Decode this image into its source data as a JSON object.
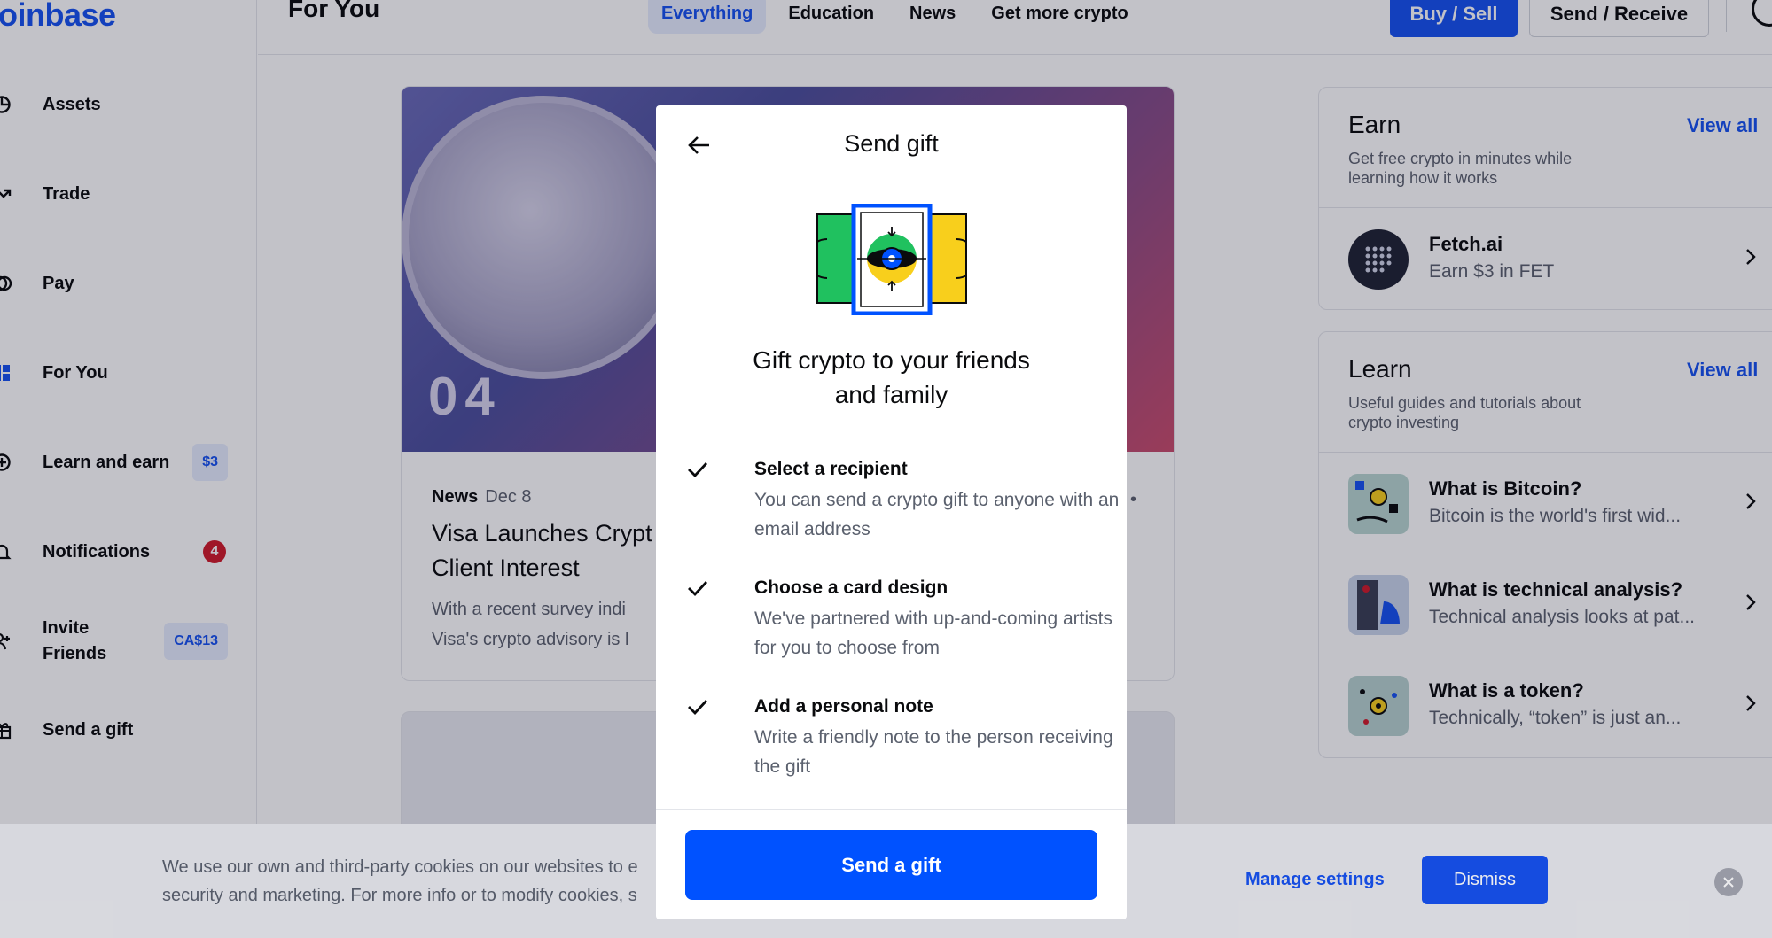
{
  "app": {
    "logo": "oinbase"
  },
  "sidebar": {
    "items": [
      {
        "label": "Assets",
        "icon": "pie-chart-icon"
      },
      {
        "label": "Trade",
        "icon": "trend-arrow-icon"
      },
      {
        "label": "Pay",
        "icon": "pay-icon"
      },
      {
        "label": "For You",
        "icon": "dashboard-icon"
      },
      {
        "label": "Learn and earn",
        "icon": "plus-circle-icon",
        "badge": "$3"
      },
      {
        "label": "Notifications",
        "icon": "bell-icon",
        "count": "4"
      },
      {
        "label": "Invite\nFriends",
        "icon": "add-user-icon",
        "badge": "CA$13"
      },
      {
        "label": "Send a gift",
        "icon": "gift-icon"
      }
    ]
  },
  "header": {
    "title": "For You",
    "tabs": [
      "Everything",
      "Education",
      "News",
      "Get more crypto"
    ],
    "active_tab": "Everything",
    "buy_sell": "Buy / Sell",
    "send_receive": "Send / Receive"
  },
  "feed": {
    "image_text": "04",
    "category": "News",
    "date": "Dec 8",
    "title": "Visa Launches Crypt\nClient Interest",
    "description": "With a recent survey indi\nVisa's crypto advisory is l",
    "dots": "•"
  },
  "earn": {
    "title": "Earn",
    "view_all": "View all",
    "subtitle": "Get free crypto in minutes while learning how it works",
    "items": [
      {
        "title": "Fetch.ai",
        "subtitle": "Earn $3 in FET",
        "thumb_color": "#1f2333"
      }
    ]
  },
  "learn": {
    "title": "Learn",
    "view_all": "View all",
    "subtitle": "Useful guides and tutorials about crypto investing",
    "items": [
      {
        "title": "What is Bitcoin?",
        "subtitle": "Bitcoin is the world's first wid...",
        "thumb_color": "#b9d6d0"
      },
      {
        "title": "What is technical analysis?",
        "subtitle": "Technical analysis looks at pat...",
        "thumb_color": "#c9d4ea"
      },
      {
        "title": "What is a token?",
        "subtitle": "Technically, “token” is just an...",
        "thumb_color": "#b7d2cf"
      }
    ]
  },
  "cookie_banner": {
    "text": "We use our own and third-party cookies on our websites to e\nsecurity and marketing. For more info or to modify cookies, s",
    "manage": "Manage settings",
    "dismiss": "Dismiss"
  },
  "modal": {
    "title": "Send gift",
    "heading": "Gift crypto to your friends\nand family",
    "steps": [
      {
        "title": "Select a recipient",
        "desc": "You can send a crypto gift to anyone with an email address"
      },
      {
        "title": "Choose a card design",
        "desc": "We've partnered with up-and-coming artists for you to choose from"
      },
      {
        "title": "Add a personal note",
        "desc": "Write a friendly note to the person receiving the gift"
      }
    ],
    "cta": "Send a gift"
  },
  "colors": {
    "brand": "#1652f0",
    "cta": "#0052ff",
    "badge_red": "#d01b2a",
    "gift_green": "#20c15f",
    "gift_yellow": "#f8cf1c",
    "gift_blue": "#0052ff"
  }
}
